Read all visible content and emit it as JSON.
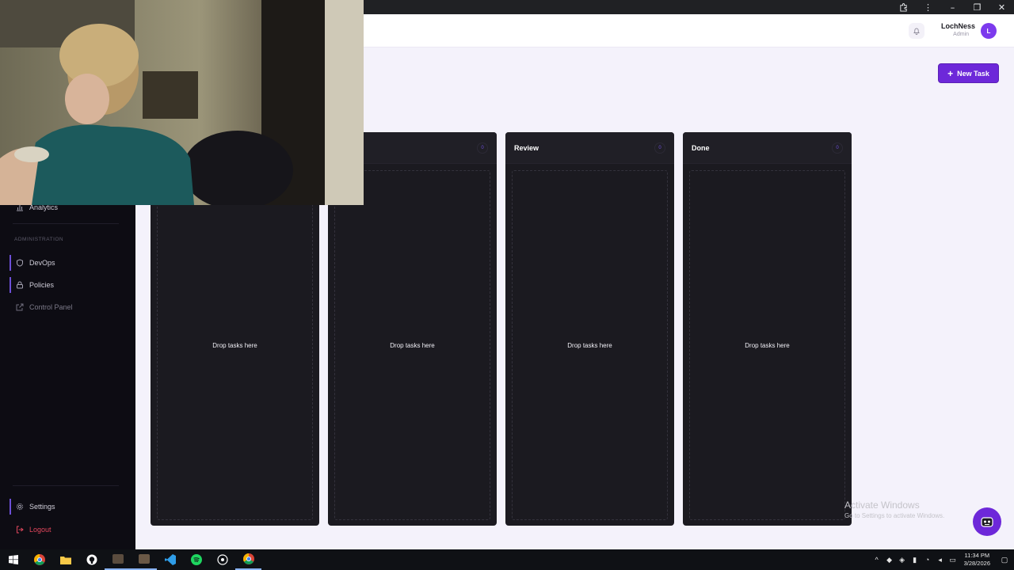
{
  "header": {
    "user_name": "LochNess",
    "user_role": "Admin",
    "avatar_initial": "L"
  },
  "sidebar": {
    "items_top": [
      {
        "label": "Analytics",
        "icon": "bar-chart-icon"
      }
    ],
    "section_admin": "ADMINISTRATION",
    "items_admin": [
      {
        "label": "DevOps",
        "icon": "shield-icon"
      },
      {
        "label": "Policies",
        "icon": "lock-icon"
      },
      {
        "label": "Control Panel",
        "icon": "external-link-icon"
      }
    ],
    "settings_label": "Settings",
    "logout_label": "Logout"
  },
  "main": {
    "new_task_label": "New Task",
    "columns": [
      {
        "title": "",
        "count": "",
        "empty_text": "Drop tasks here"
      },
      {
        "title": "ress",
        "count": "0",
        "empty_text": "Drop tasks here"
      },
      {
        "title": "Review",
        "count": "0",
        "empty_text": "Drop tasks here"
      },
      {
        "title": "Done",
        "count": "0",
        "empty_text": "Drop tasks here"
      }
    ]
  },
  "windows_watermark": {
    "title": "Activate Windows",
    "subtitle": "Go to Settings to activate Windows."
  },
  "taskbar": {
    "time": "11:34 PM",
    "date": "3/28/2026"
  },
  "colors": {
    "accent": "#6d28d9",
    "sidebar_bg": "#0d0c13",
    "column_bg": "#1b1a20",
    "page_bg": "#f4f2fb"
  }
}
